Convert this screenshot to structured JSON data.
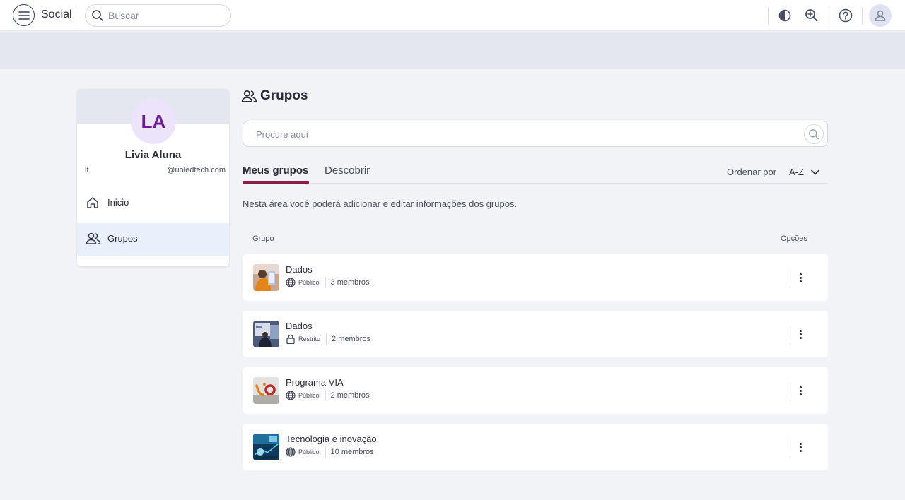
{
  "header": {
    "app_title": "Social",
    "search_placeholder": "Buscar",
    "icons": [
      "menu-icon",
      "search-icon",
      "contrast-icon",
      "zoom-icon",
      "help-icon",
      "user-icon"
    ]
  },
  "profile": {
    "initials": "LA",
    "name": "Livia Aluna",
    "handle": "lt",
    "email": "@uoledtech.com"
  },
  "sidebar": {
    "items": [
      {
        "label": "Inicio",
        "icon": "home-icon",
        "active": false
      },
      {
        "label": "Grupos",
        "icon": "users-icon",
        "active": true
      }
    ]
  },
  "main": {
    "title": "Grupos",
    "search_placeholder": "Procure aqui",
    "tabs": [
      {
        "label": "Meus grupos",
        "active": true
      },
      {
        "label": "Descobrir",
        "active": false
      }
    ],
    "sort_label": "Ordenar por",
    "sort_value": "A-Z",
    "description": "Nesta área você poderá adicionar e editar informações dos grupos.",
    "columns": {
      "group": "Grupo",
      "options": "Opções"
    },
    "groups": [
      {
        "name": "Dados",
        "privacy": "Público",
        "privacy_icon": "globe-icon",
        "members": "3 membros"
      },
      {
        "name": "Dados",
        "privacy": "Restrito",
        "privacy_icon": "lock-icon",
        "members": "2 membros"
      },
      {
        "name": "Programa VIA",
        "privacy": "Público",
        "privacy_icon": "globe-icon",
        "members": "2 membros"
      },
      {
        "name": "Tecnologia e inovação",
        "privacy": "Público",
        "privacy_icon": "globe-icon",
        "members": "10 membros"
      }
    ]
  },
  "colors": {
    "accent": "#8a1c4a",
    "avatar_text": "#6c1a9a",
    "background": "#f2f3f7",
    "banner": "#e4e7f0"
  }
}
